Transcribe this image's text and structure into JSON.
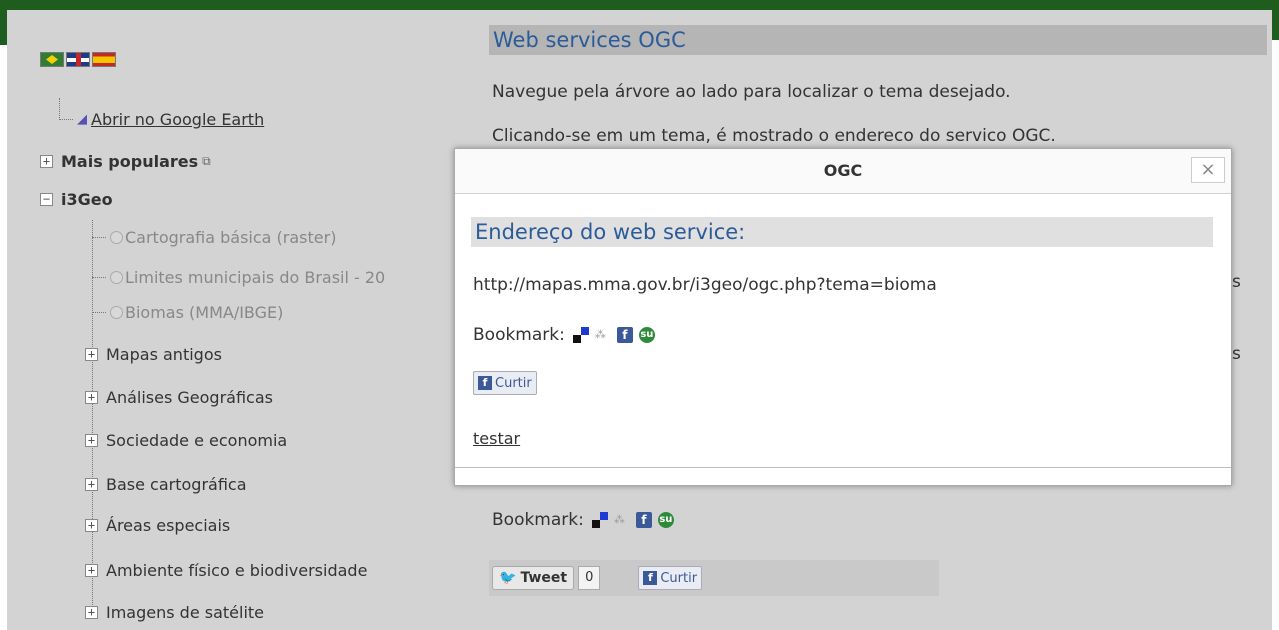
{
  "languages": [
    {
      "name": "pt-br-flag-icon"
    },
    {
      "name": "en-flag-icon"
    },
    {
      "name": "es-flag-icon"
    }
  ],
  "tree": {
    "google_earth_link": "Abrir no Google Earth",
    "mais_populares": "Mais populares",
    "i3geo": "i3Geo",
    "themes": [
      "Cartografia básica (raster)",
      "Limites municipais do Brasil - 20",
      "Biomas (MMA/IBGE)"
    ],
    "groups": [
      "Mapas antigos",
      "Análises Geográficas",
      "Sociedade e economia",
      "Base cartográfica",
      "Áreas especiais",
      "Ambiente físico e biodiversidade",
      "Imagens de satélite"
    ]
  },
  "main": {
    "title": "Web services OGC",
    "p1": "Navegue pela árvore ao lado para localizar o tema desejado.",
    "p2": "Clicando-se em um tema, é mostrado o endereco do servico OGC.",
    "bookmark_label": "Bookmark:",
    "tweet_label": "Tweet",
    "tweet_count": "0",
    "like_label": "Curtir"
  },
  "dialog": {
    "title": "OGC",
    "close": "×",
    "section_title": "Endereço do web service:",
    "url": "http://mapas.mma.gov.br/i3geo/ogc.php?tema=bioma",
    "bookmark_label": "Bookmark:",
    "like_label": "Curtir",
    "test_link": "testar"
  },
  "colors": {
    "header_green": "#1f5d1f",
    "title_blue": "#2b5b98",
    "facebook_blue": "#3b5998"
  }
}
